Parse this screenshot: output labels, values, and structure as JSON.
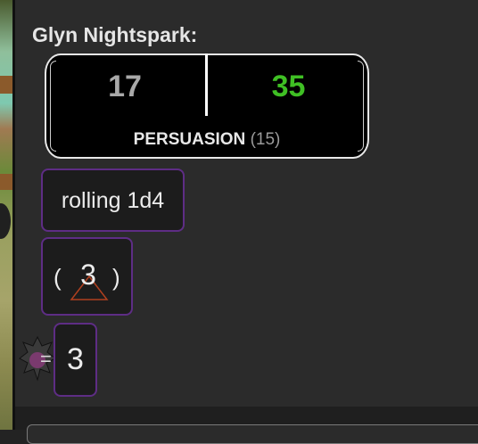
{
  "chat": {
    "speaker": "Glyn Nightspark:",
    "check": {
      "left_roll": "17",
      "right_roll": "35",
      "skill": "PERSUASION",
      "modifier": "(15)"
    },
    "roll": {
      "command": "rolling 1d4",
      "paren_open": "(",
      "die_result": "3",
      "paren_close": ")",
      "equals": "=",
      "total": "3"
    }
  },
  "icons": {
    "die": "d4-triangle-icon",
    "token": "character-token-icon"
  },
  "colors": {
    "success": "#3fbf24",
    "neutral_roll": "#a9a9a9",
    "pill_border": "#5e2d85",
    "panel_bg": "#2b2b2b",
    "die_outline": "#b0401f"
  }
}
